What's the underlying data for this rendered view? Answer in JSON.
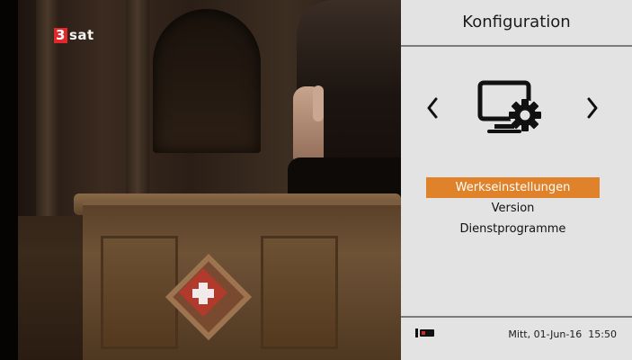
{
  "channel": {
    "logo_number": "3",
    "logo_text": "sat"
  },
  "panel": {
    "title": "Konfiguration",
    "icon": "monitor-gear-icon",
    "nav": {
      "prev_icon": "chevron-left-icon",
      "next_icon": "chevron-right-icon"
    },
    "menu_items": [
      {
        "label": "Werkseinstellungen",
        "selected": true
      },
      {
        "label": "Version",
        "selected": false
      },
      {
        "label": "Dienstprogramme",
        "selected": false
      }
    ],
    "footer": {
      "signal_icon": "remote-signal-icon",
      "datetime": "Mitt, 01-Jun-16  15:50"
    }
  },
  "colors": {
    "panel_bg": "#e3e3e3",
    "selection": "#e0822a",
    "logo_red": "#e3262a"
  }
}
